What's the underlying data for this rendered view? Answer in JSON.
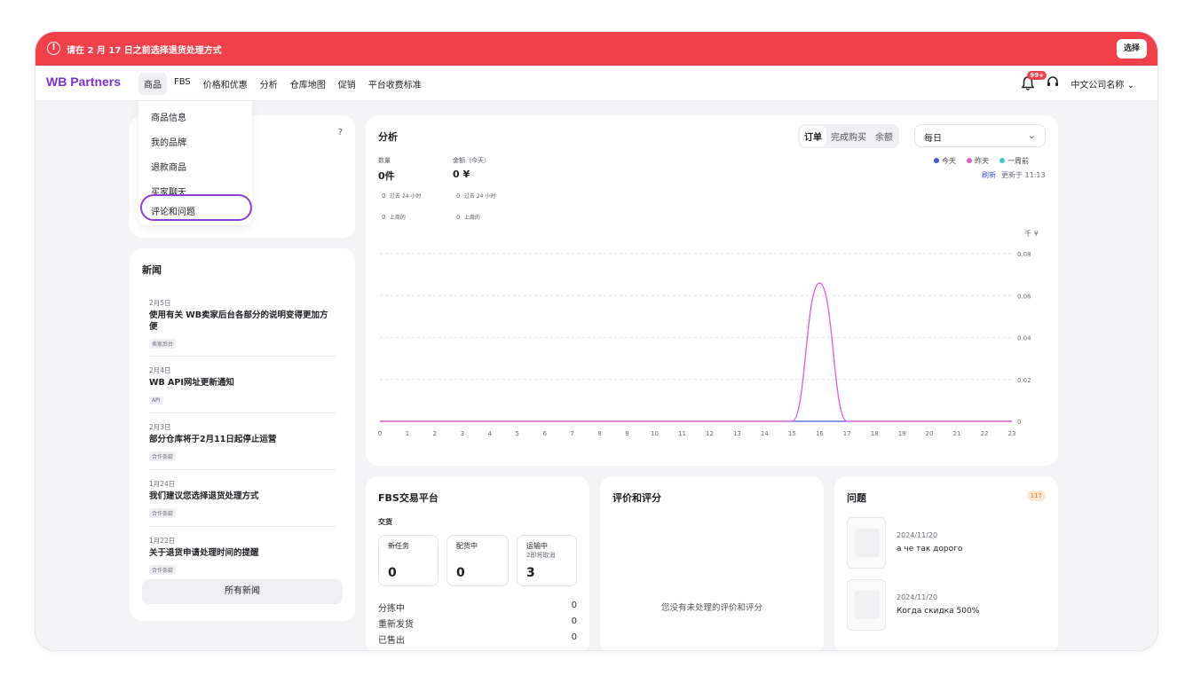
{
  "banner": {
    "text": "请在 2 月 17 日之前选择退货处理方式",
    "button": "选择",
    "color": "#f2404a"
  },
  "brand": {
    "logo": "WB Partners",
    "color": "#7a2fd1"
  },
  "nav": {
    "items": [
      "商品",
      "FBS",
      "价格和优惠",
      "分析",
      "仓库地图",
      "促销",
      "平台收费标准"
    ],
    "notif_badge": "99+",
    "company": "中文公司名称"
  },
  "dropdown": {
    "items": [
      "商品信息",
      "我的品牌",
      "退款商品",
      "买家聊天",
      "评论和问题"
    ],
    "highlight_color": "#8a3fd6"
  },
  "help_card": {
    "help_icon": "?"
  },
  "analytics": {
    "title": "分析",
    "tabs": [
      "订单",
      "完成购买",
      "余额"
    ],
    "period": "每日",
    "qty_label": "数量",
    "qty_value": "0件",
    "amount_label": "金额（今天）",
    "amount_value": "0 ¥",
    "qty_24h_val": "0",
    "qty_24h_label": "过去 24 小时",
    "amt_24h_val": "0",
    "amt_24h_label": "过去 24 小时",
    "qty_week_val": "0",
    "qty_week_label": "上周的",
    "amt_week_val": "0",
    "amt_week_label": "上周的",
    "legend": [
      {
        "label": "今天",
        "color": "#4a55d8"
      },
      {
        "label": "昨天",
        "color": "#e05ad0"
      },
      {
        "label": "一周前",
        "color": "#3fc7c7"
      }
    ],
    "refresh": "刷新",
    "updated": "更新于 11:13",
    "unit": "千 ¥"
  },
  "chart_data": {
    "type": "line",
    "x": [
      0,
      1,
      2,
      3,
      4,
      5,
      6,
      7,
      8,
      9,
      10,
      11,
      12,
      13,
      14,
      15,
      16,
      17,
      18,
      19,
      20,
      21,
      22,
      23
    ],
    "ylim": [
      0,
      0.08
    ],
    "yticks": [
      0,
      0.02,
      0.04,
      0.06,
      0.08
    ],
    "ylabel": "千 ¥",
    "series": [
      {
        "name": "今天",
        "color": "#4a55d8",
        "values": [
          0,
          0,
          0,
          0,
          0,
          0,
          0,
          0,
          0,
          0,
          0,
          0,
          0,
          0,
          0,
          0,
          0,
          0,
          0,
          0,
          0,
          0,
          0,
          0
        ]
      },
      {
        "name": "昨天",
        "color": "#e05ad0",
        "values": [
          0,
          0,
          0,
          0,
          0,
          0,
          0,
          0,
          0,
          0,
          0,
          0,
          0,
          0,
          0,
          0,
          0.066,
          0,
          0,
          0,
          0,
          0,
          0,
          0
        ]
      }
    ]
  },
  "news": {
    "title": "新闻",
    "items": [
      {
        "date": "2月5日",
        "title": "使用有关 WB卖家后台各部分的说明变得更加方便",
        "tag": "卖家后台"
      },
      {
        "date": "2月4日",
        "title": "WB API网址更新通知",
        "tag": "API"
      },
      {
        "date": "2月3日",
        "title": "部分仓库将于2月11日起停止运营",
        "tag": "合作条款"
      },
      {
        "date": "1月24日",
        "title": "我们建议您选择退货处理方式",
        "tag": "合作条款"
      },
      {
        "date": "1月22日",
        "title": "关于退货申请处理时间的提醒",
        "tag": "合作条款"
      }
    ],
    "all_button": "所有新闻"
  },
  "fbs": {
    "title": "FBS交易平台",
    "section": "交货",
    "boxes": [
      {
        "label": "新任务",
        "sub": "",
        "value": "0"
      },
      {
        "label": "配货中",
        "sub": "",
        "value": "0"
      },
      {
        "label": "运输中",
        "sub": "2即将取消",
        "value": "3"
      }
    ],
    "rows": [
      {
        "label": "分拣中",
        "value": "0"
      },
      {
        "label": "重新发货",
        "value": "0"
      },
      {
        "label": "已售出",
        "value": "0"
      }
    ]
  },
  "reviews": {
    "title": "评价和评分",
    "empty": "您没有未处理的评价和评分"
  },
  "questions": {
    "title": "问题",
    "count": "117",
    "items": [
      {
        "date": "2024/11/20",
        "text": "а че так дорого"
      },
      {
        "date": "2024/11/20",
        "text": "Когда скидка 500%"
      }
    ]
  }
}
